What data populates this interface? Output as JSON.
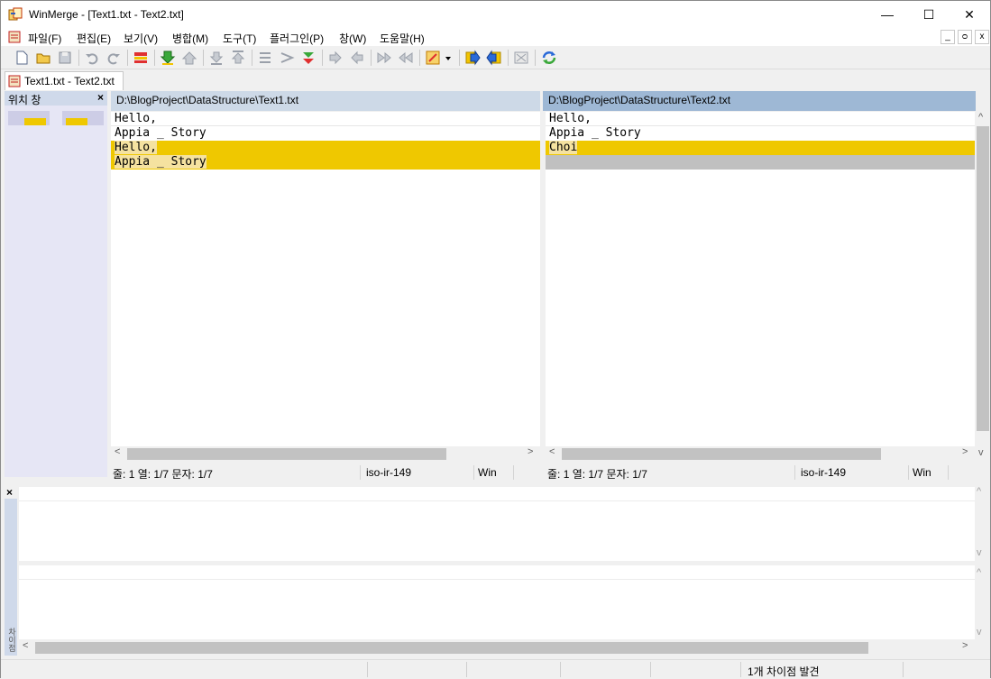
{
  "window": {
    "title": "WinMerge - [Text1.txt - Text2.txt]",
    "min_glyph": "—",
    "max_glyph": "☐",
    "close_glyph": "✕"
  },
  "menu": {
    "items": [
      "파일(F)",
      "편집(E)",
      "보기(V)",
      "병합(M)",
      "도구(T)",
      "플러그인(P)",
      "창(W)",
      "도움말(H)"
    ],
    "mdi": [
      "_",
      "ᴑ",
      "x"
    ]
  },
  "tab": {
    "label": "Text1.txt - Text2.txt"
  },
  "location_pane": {
    "title": "위치 창",
    "close": "×"
  },
  "left": {
    "path": "D:\\BlogProject\\DataStructure\\Text1.txt",
    "lines": [
      "Hello,",
      "Appia _ Story",
      "Hello,",
      "Appia _ Story"
    ],
    "status": {
      "pos": "줄: 1  열: 1/7  문자: 1/7",
      "encoding": "iso-ir-149",
      "eol": "Win"
    }
  },
  "right": {
    "path": "D:\\BlogProject\\DataStructure\\Text2.txt",
    "lines": [
      "Hello,",
      "Appia _ Story",
      "Choi",
      ""
    ],
    "status": {
      "pos": "줄: 1  열: 1/7  문자: 1/7",
      "encoding": "iso-ir-149",
      "eol": "Win"
    }
  },
  "diff_pane": {
    "close": "×",
    "side_label": "차이점"
  },
  "statusbar": {
    "text": "1개 차이점 발견"
  },
  "colors": {
    "diff_highlight": "#efc800",
    "missing_line": "#c0c0c0"
  }
}
